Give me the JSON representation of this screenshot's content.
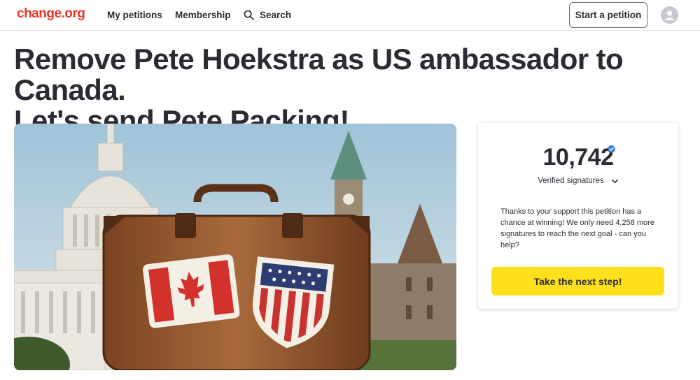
{
  "header": {
    "logo": "change.org",
    "nav": [
      "My petitions",
      "Membership",
      "Search"
    ],
    "start_button": "Start a petition"
  },
  "petition": {
    "title_line1": "Remove Pete Hoekstra as US ambassador to Canada.",
    "title_line2": "Let's send Pete Packing!"
  },
  "signatures": {
    "count": "10,742",
    "label": "Verified signatures",
    "message": "Thanks to your support this petition has a chance at winning! We only need 4,258 more signatures to reach the next goal - can you help?",
    "cta": "Take the next step!"
  },
  "icons": {
    "search": "search-icon",
    "avatar": "user-avatar-icon",
    "verified": "verified-check-icon",
    "expand": "chevron-down-icon"
  },
  "colors": {
    "brand": "#e8382c",
    "cta": "#ffe01b",
    "verified": "#3b7ddd",
    "text": "#2c2b33"
  }
}
